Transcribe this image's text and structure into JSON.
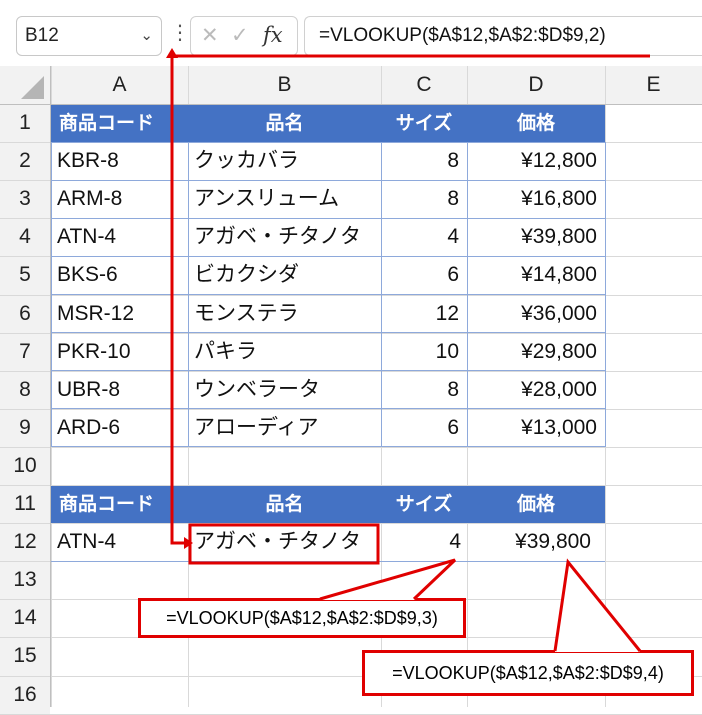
{
  "formula_bar": {
    "name_box": "B12",
    "fx_label": "fx",
    "formula": "=VLOOKUP($A$12,$A$2:$D$9,2)"
  },
  "columns": [
    "A",
    "B",
    "C",
    "D",
    "E"
  ],
  "rows": [
    "1",
    "2",
    "3",
    "4",
    "5",
    "6",
    "7",
    "8",
    "9",
    "10",
    "11",
    "12",
    "13",
    "14",
    "15",
    "16"
  ],
  "table": {
    "headers": [
      "商品コード",
      "品名",
      "サイズ",
      "価格"
    ],
    "data": [
      [
        "KBR-8",
        "クッカバラ",
        "8",
        "¥12,800"
      ],
      [
        "ARM-8",
        "アンスリューム",
        "8",
        "¥16,800"
      ],
      [
        "ATN-4",
        "アガベ・チタノタ",
        "4",
        "¥39,800"
      ],
      [
        "BKS-6",
        "ビカクシダ",
        "6",
        "¥14,800"
      ],
      [
        "MSR-12",
        "モンステラ",
        "12",
        "¥36,000"
      ],
      [
        "PKR-10",
        "パキラ",
        "10",
        "¥29,800"
      ],
      [
        "UBR-8",
        "ウンベラータ",
        "8",
        "¥28,000"
      ],
      [
        "ARD-6",
        "アローディア",
        "6",
        "¥13,000"
      ]
    ]
  },
  "lookup": {
    "headers": [
      "商品コード",
      "品名",
      "サイズ",
      "価格"
    ],
    "row": [
      "ATN-4",
      "アガベ・チタノタ",
      "4",
      "¥39,800"
    ]
  },
  "callouts": {
    "size_formula": "=VLOOKUP($A$12,$A$2:$D$9,3)",
    "price_formula": "=VLOOKUP($A$12,$A$2:$D$9,4)"
  },
  "colors": {
    "header_fill": "#4472c4",
    "annotation_red": "#e00000"
  }
}
